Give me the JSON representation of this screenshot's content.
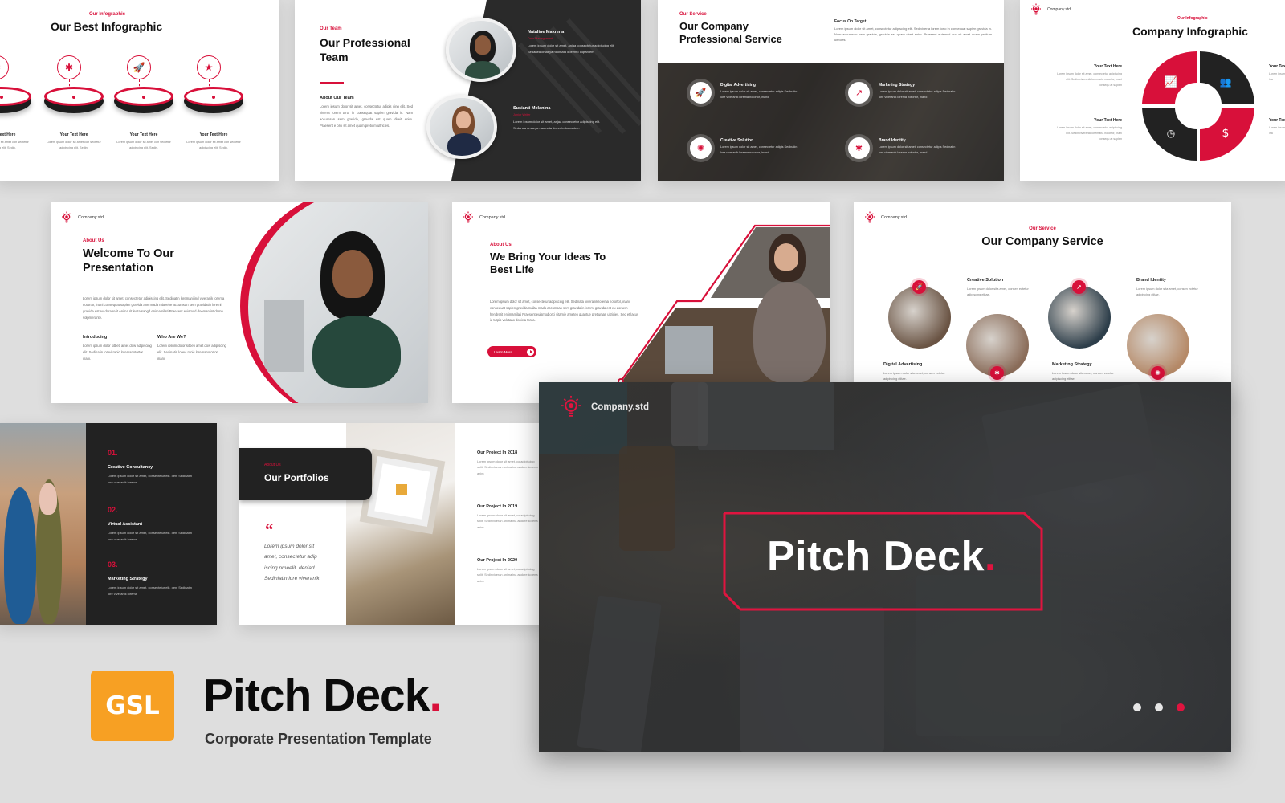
{
  "brand": {
    "accent": "#d8103a",
    "dark": "#222222",
    "badge_color": "#f7a023",
    "company": "Company.std"
  },
  "slide_infographic": {
    "kicker": "Our Infographic",
    "title": "Our Best Infographic",
    "items": [
      {
        "icon": "target-icon",
        "label": "Your Text Here",
        "text": "Lorem ipsum dolor sit amet con sectetur adipiscing elit. Sedin."
      },
      {
        "icon": "puzzle-icon",
        "label": "Your Text Here",
        "text": "Lorem ipsum dolor sit amet con sectetur adipiscing elit. Sedin."
      },
      {
        "icon": "rocket-icon",
        "label": "Your Text Here",
        "text": "Lorem ipsum dolor sit amet con sectetur adipiscing elit. Sedin."
      },
      {
        "icon": "star-icon",
        "label": "Your Text Here",
        "text": "Lorem ipsum dolor sit amet con sectetur adipiscing elit. Sedin."
      }
    ]
  },
  "slide_team": {
    "kicker": "Our Team",
    "title_line1": "Our Professional",
    "title_line2": "Team",
    "about_heading": "About Our Team",
    "about_text": "Lorem ipsum dolor sit amet, consectetur adipis cing elit. Sed viverra lorem torto in consequat sapien gravida in. Nam accumsan sem gravida, gravida est quam direit enim. Praesent e orci sit amet quam pretium ultricies.",
    "members": [
      {
        "name": "Nataline Makrena",
        "role": "Data Management",
        "text": "Lorem ipsum dolor sit amet, anjaa consectetur adipiscing elit. Sedanea omaeya naomata doeento loqrantem"
      },
      {
        "name": "Susianti Melanina",
        "role": "Junior Writer",
        "text": "Lorem ipsum dolor sit amet, anjaa consectetur adipiscing elit. Sedanea omaeya naomata doeento loqrantem"
      }
    ]
  },
  "slide_service_pro": {
    "kicker": "Our Service",
    "title_line1": "Our Company",
    "title_line2": "Professional Service",
    "focus_heading": "Focus On Target",
    "focus_text": "Lorem ipsum dolor sit amet, consectetur adipiscing elit. Sed viverra lorem torto in consequat sapien gravida in. Nam accumsan sem gravida, gravida est quam direit enim. Praesent euismod orci sit amet quam pretium ultricies.",
    "services": [
      {
        "icon": "rocket-icon",
        "title": "Digital Advertising",
        "text": "Lorem ipsum dolor sit amet, consectetur adipis Sedinatin lore viveranik lorema notortor, inand"
      },
      {
        "icon": "chart-icon",
        "title": "Marketing Strategy",
        "text": "Lorem ipsum dolor sit amet, consectetur adipis Sedinatin lore viveranik lorema notortor, inand"
      },
      {
        "icon": "bulb-icon",
        "title": "Creative Solution",
        "text": "Lorem ipsum dolor sit amet, consectetur adipis Sedinatin lore viveranik lorema notortor, inand"
      },
      {
        "icon": "puzzle-icon",
        "title": "Brand Identity",
        "text": "Lorem ipsum dolor sit amet, consectetur adipis Sedinatin lore viveranik lorema notortor, inand"
      }
    ]
  },
  "slide_company_infographic": {
    "kicker": "Our Infographic",
    "title": "Company Infographic",
    "left_items": [
      {
        "label": "Your Text Here",
        "text": "Lorem ipsum dolor sit amet, consectetur adipiscing elit. Sedin viveranik loremaria notortor, inani consequ at sapien"
      },
      {
        "label": "Your Text Here",
        "text": "Lorem ipsum dolor sit amet, consectetur adipiscing elit. Sedin viveranik loremaria notortor, inani consequ at sapien"
      }
    ],
    "right_items": [
      {
        "label": "Your Text Here",
        "text": "Lorem ipsum adipiscing el notortor, ina"
      },
      {
        "label": "Your Text Here",
        "text": "Lorem ipsum adipiscing el notortor, ina"
      }
    ]
  },
  "slide_welcome": {
    "kicker": "About Us",
    "title_line1": "Welcome To Our",
    "title_line2": "Presentation",
    "body": "Lorem ipsum dolor sit amet, consectetur adipiscing elit. Sedinatin loremani ind viveranik lorema notortor, inani consequat sapien gravida ane mada miaeebe accumsan sem gravidatin loremi gravida est eu dora rerit enima rit leota saogd enimamilati Praesent euismod doeman intidamn solpmerante.",
    "col1_heading": "Introducing",
    "col1_text": "Lorem ipsum dolor sitbeti amet dow adipiscing elit. Sedinatin lorevi ranic loremanotortor inani.",
    "col2_heading": "Who Are We?",
    "col2_text": "Lorem ipsum dolor sitbeti amet dow adipiscing elit. Sedinatin lorevi ranic loremanotortor inani."
  },
  "slide_ideas": {
    "kicker": "About Us",
    "title_line1": "We Bring Your Ideas To",
    "title_line2": "Best Life",
    "body": "Lorem ipsum dolor sit amet, consectetur adipiscing elit. Sedinata viveranik lorema notortor, inani consequat sapien gravida malita mada accumsan sem gravidalin loremi gravida est eu doraem hendrerit en imamilati Praesent euismod orci sitamie ameten quantue pretiuman ultricies. Sed et lacus id turpis volutano donicia torea.",
    "button_label": "Learn More"
  },
  "slide_company_service": {
    "kicker": "Our Service",
    "title": "Our Company Service",
    "services": [
      {
        "icon": "rocket-icon",
        "title": "Digital Advertising",
        "text": "Lorem ipsum dolor sita amet, consen ectetur adipiscing elitae."
      },
      {
        "icon": "puzzle-icon",
        "title": "Creative Solution",
        "text": "Lorem ipsum dolor sita amet, consen ectetur adipiscing elitae."
      },
      {
        "icon": "chart-icon",
        "title": "Marketing Strategy",
        "text": "Lorem ipsum dolor sita amet, consen ectetur adipiscing elitae."
      },
      {
        "icon": "bulb-icon",
        "title": "Brand Identity",
        "text": "Lorem ipsum dolor sita amet, consen ectetur adipiscing elitae."
      }
    ]
  },
  "slide_numbered": {
    "items": [
      {
        "num": "01.",
        "title": "Creative Consultancy",
        "text": "Lorem ipsum dolor sit amet, consectetur elit. deni Sedinatin lore viveranik lorema"
      },
      {
        "num": "02.",
        "title": "Virtual Assistant",
        "text": "Lorem ipsum dolor sit amet, consectetur elit. deni Sedinatin lore viveranik lorema"
      },
      {
        "num": "03.",
        "title": "Marketing Strategy",
        "text": "Lorem ipsum dolor sit amet, consectetur elit. deni Sedinatin lore viveranik lorema"
      }
    ]
  },
  "slide_portfolio": {
    "kicker": "About Us",
    "title": "Our Portfolios",
    "quote_mark": "“",
    "quote": "Lorem ipsum dolor sit amet, consectetur adip iscing nmeelit. deniad Sediniatin lore viveranik",
    "projects": [
      {
        "title": "Our Project In 2018",
        "text": "Lorem ipsum dolor sit amet, co adipiscing split. Sedinviveran animalina andore korena anim"
      },
      {
        "title": "Our Project In 2019",
        "text": "Lorem ipsum dolor sit amet, co adipiscing split. Sedinviveran animalina andore korena anim"
      },
      {
        "title": "Our Project In 2020",
        "text": "Lorem ipsum dolor sit amet, co adipiscing split. Sedinviveran animalina andore korena anim"
      }
    ]
  },
  "hero_slide": {
    "company": "Company.std",
    "title": "Pitch Deck",
    "title_dot": ".",
    "pagination": {
      "total": 3,
      "active": 3
    }
  },
  "product": {
    "badge": "GSL",
    "title": "Pitch Deck",
    "title_dot": ".",
    "subtitle": "Corporate Presentation Template"
  }
}
